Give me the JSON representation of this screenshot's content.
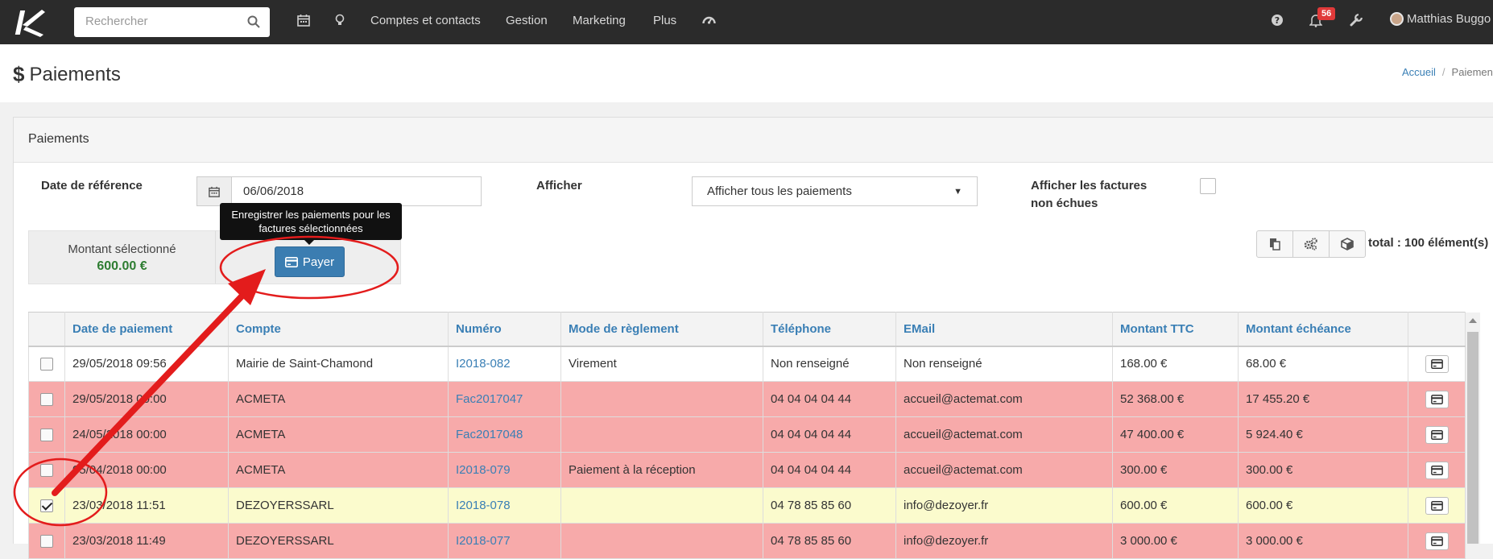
{
  "topbar": {
    "search_placeholder": "Rechercher",
    "nav": [
      "Comptes et contacts",
      "Gestion",
      "Marketing",
      "Plus"
    ],
    "notification_count": "56",
    "user_name": "Matthias Buggo"
  },
  "header": {
    "title": "Paiements",
    "breadcrumb": {
      "home": "Accueil",
      "current": "Paiements"
    }
  },
  "panel": {
    "title": "Paiements",
    "filters": {
      "date_label": "Date de référence",
      "date_value": "06/06/2018",
      "afficher_label": "Afficher",
      "afficher_value": "Afficher tous les paiements",
      "non_echues_label_line1": "Afficher les factures",
      "non_echues_label_line2": "non échues"
    },
    "selection": {
      "label": "Montant sélectionné",
      "amount": "600.00 €",
      "pay_button": "Payer",
      "tooltip_line1": "Enregistrer les paiements pour les",
      "tooltip_line2": "factures sélectionnées"
    },
    "total_label": "total : 100 élément(s)"
  },
  "table": {
    "columns": [
      "Date de paiement",
      "Compte",
      "Numéro",
      "Mode de règlement",
      "Téléphone",
      "EMail",
      "Montant TTC",
      "Montant échéance"
    ],
    "rows": [
      {
        "date": "29/05/2018 09:56",
        "compte": "Mairie de Saint-Chamond",
        "numero": "I2018-082",
        "mode": "Virement",
        "telephone": "Non renseigné",
        "email": "Non renseigné",
        "ttc": "168.00 €",
        "echeance": "68.00 €",
        "style": "white",
        "checked": false
      },
      {
        "date": "29/05/2018 00:00",
        "compte": "ACMETA",
        "numero": "Fac2017047",
        "mode": "",
        "telephone": "04 04 04 04 44",
        "email": "accueil@actemat.com",
        "ttc": "52 368.00 €",
        "echeance": "17 455.20 €",
        "style": "red",
        "checked": false
      },
      {
        "date": "24/05/2018 00:00",
        "compte": "ACMETA",
        "numero": "Fac2017048",
        "mode": "",
        "telephone": "04 04 04 04 44",
        "email": "accueil@actemat.com",
        "ttc": "47 400.00 €",
        "echeance": "5 924.40 €",
        "style": "red",
        "checked": false
      },
      {
        "date": "05/04/2018 00:00",
        "compte": "ACMETA",
        "numero": "I2018-079",
        "mode": "Paiement à la réception",
        "telephone": "04 04 04 04 44",
        "email": "accueil@actemat.com",
        "ttc": "300.00 €",
        "echeance": "300.00 €",
        "style": "red",
        "checked": false
      },
      {
        "date": "23/03/2018 11:51",
        "compte": "DEZOYERSSARL",
        "numero": "I2018-078",
        "mode": "",
        "telephone": "04 78 85 85 60",
        "email": "info@dezoyer.fr",
        "ttc": "600.00 €",
        "echeance": "600.00 €",
        "style": "yellow",
        "checked": true
      },
      {
        "date": "23/03/2018 11:49",
        "compte": "DEZOYERSSARL",
        "numero": "I2018-077",
        "mode": "",
        "telephone": "04 78 85 85 60",
        "email": "info@dezoyer.fr",
        "ttc": "3 000.00 €",
        "echeance": "3 000.00 €",
        "style": "red",
        "checked": false
      }
    ]
  },
  "colors": {
    "topbar": "#2b2b2b",
    "link": "#3a7fb5",
    "row_overdue": "#f7aaaa",
    "row_selected": "#fbfbcd",
    "amount_green": "#2e7d32",
    "annotation_red": "#e31c1c"
  },
  "icons": {
    "topbar": [
      "calendar-icon",
      "lightbulb-icon",
      "dashboard-icon",
      "help-icon",
      "bell-icon",
      "wrench-icon"
    ],
    "toolbar": [
      "copy-icon",
      "settings-icon",
      "box-icon"
    ],
    "row_action": "credit-card-icon"
  }
}
